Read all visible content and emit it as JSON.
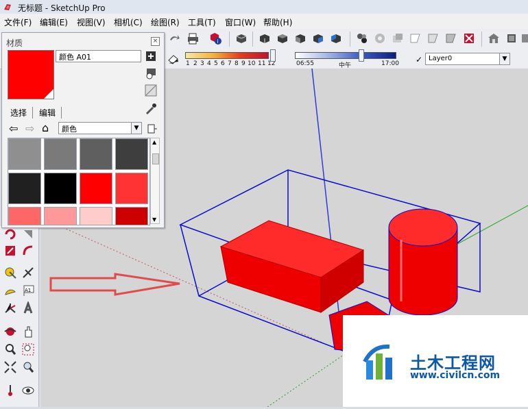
{
  "window": {
    "title": "无标题 - SketchUp Pro"
  },
  "menubar": {
    "items": [
      "文件(F)",
      "编辑(E)",
      "视图(V)",
      "相机(C)",
      "绘图(R)",
      "工具(T)",
      "窗口(W)",
      "帮助(H)"
    ]
  },
  "shadows": {
    "month_labels": [
      "1",
      "2",
      "3",
      "4",
      "5",
      "6",
      "7",
      "8",
      "9",
      "10",
      "11",
      "12"
    ],
    "time_start": "06:55",
    "time_mid": "中午",
    "time_end": "17:00"
  },
  "layers": {
    "current": "Layer0"
  },
  "materials_panel": {
    "title": "材质",
    "material_name": "颜色 A01",
    "current_color": "#ff0000",
    "tabs": [
      "选择",
      "编辑"
    ],
    "category": "颜色",
    "swatches": [
      "#8f8f8f",
      "#7a7a7a",
      "#5f5f5f",
      "#3e3e3e",
      "#202020",
      "#000000",
      "#ff0000",
      "#ff3333",
      "#ff6666",
      "#ff9999",
      "#ffcccc",
      "#cc0000"
    ]
  },
  "watermark": {
    "main": "土木工程网",
    "url": "www.civilcn.com"
  }
}
